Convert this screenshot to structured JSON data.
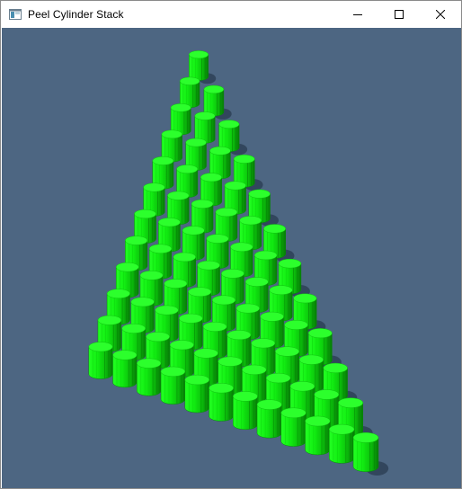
{
  "window": {
    "title": "Peel Cylinder Stack",
    "app_icon": "window-app-icon",
    "controls": {
      "minimize_icon": "minimize-icon",
      "maximize_icon": "maximize-icon",
      "close_icon": "close-icon"
    }
  },
  "scene": {
    "background_color": "#4d6682",
    "cylinder_color": "#18ff18",
    "cylinder_dark": "#0a9a0a",
    "cylinder_top": "#2cff2c",
    "shadow_color": "#2a3c50",
    "rows": 12,
    "description_shape": "triangular stack"
  }
}
